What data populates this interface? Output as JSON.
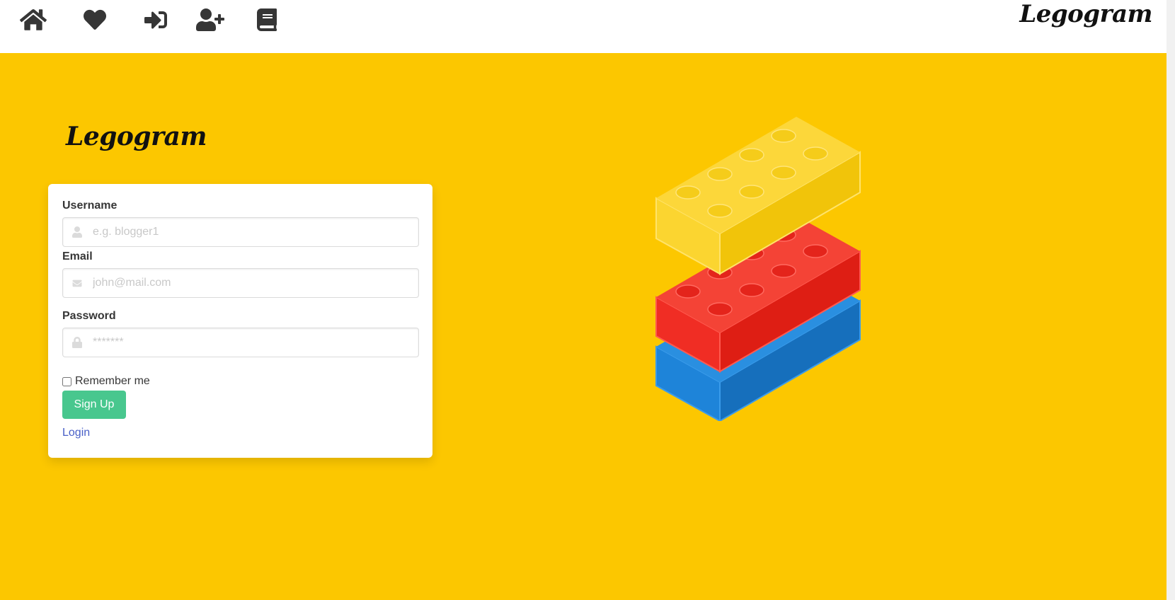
{
  "topbar": {
    "icons": [
      {
        "name": "home-icon"
      },
      {
        "name": "heart-icon"
      },
      {
        "name": "sign-in-icon"
      },
      {
        "name": "user-plus-icon"
      },
      {
        "name": "book-icon"
      }
    ],
    "brand": "Legogram"
  },
  "hero": {
    "title": "Legogram",
    "background_color": "#fcc700"
  },
  "form": {
    "username": {
      "label": "Username",
      "placeholder": "e.g. blogger1",
      "value": ""
    },
    "email": {
      "label": "Email",
      "placeholder": "john@mail.com",
      "value": ""
    },
    "password": {
      "label": "Password",
      "placeholder": "*******",
      "value": ""
    },
    "remember_label": "Remember me",
    "remember_checked": false,
    "submit_label": "Sign Up",
    "login_link": "Login",
    "submit_color": "#48c78e",
    "link_color": "#485fc7"
  },
  "illustration": {
    "name": "lego-bricks-illustration",
    "brick_colors": [
      "#fbd32f",
      "#e8271f",
      "#1d7fd6"
    ]
  }
}
